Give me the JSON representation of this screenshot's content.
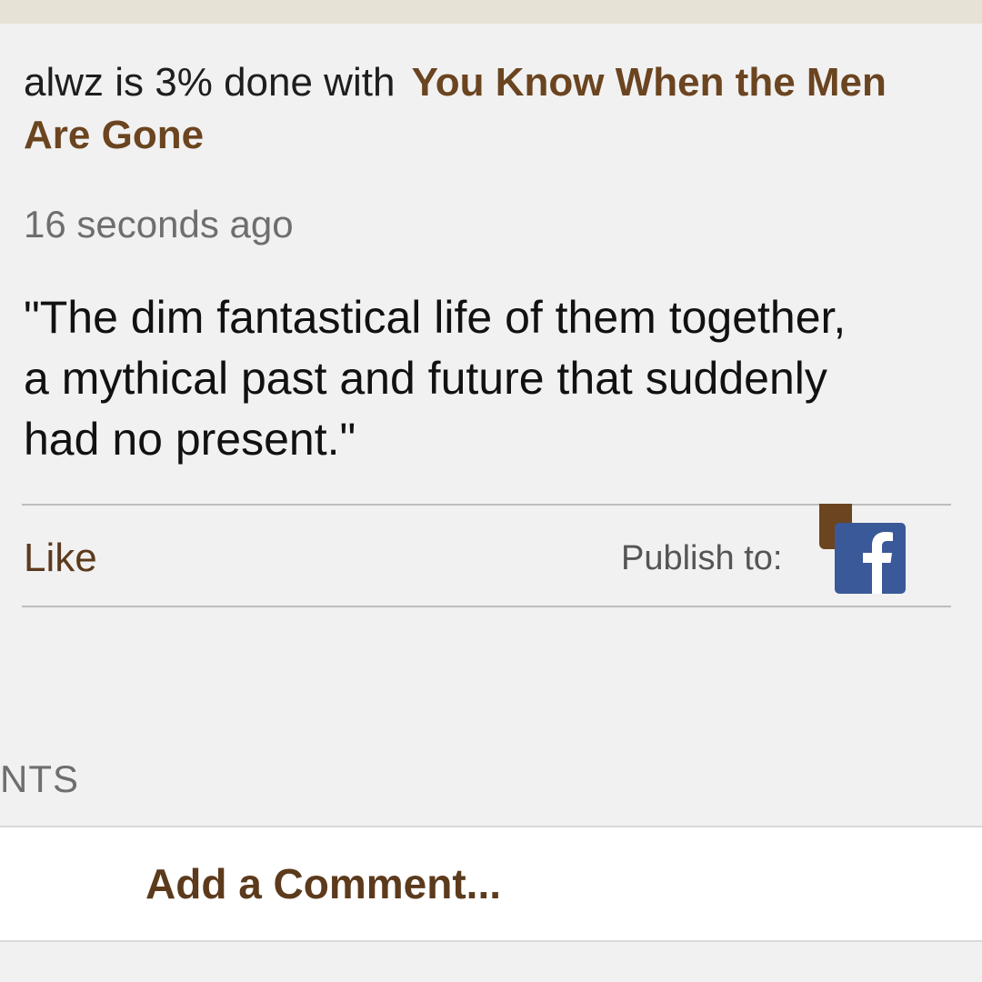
{
  "update": {
    "status_prefix": "alwz is 3% done with",
    "book_title": "You Know When the Men Are Gone",
    "progress_percent": 3,
    "timestamp": "16 seconds ago",
    "quote": "\"The dim fantastical life of them together,\na mythical past and future that suddenly\nhad no present.\""
  },
  "actions": {
    "like_label": "Like",
    "publish_label": "Publish to:",
    "publish_target_icon": "facebook-icon"
  },
  "comments": {
    "header": "NTS",
    "add_comment_label": "Add a Comment..."
  },
  "colors": {
    "link_brown": "#6b4420",
    "facebook_blue": "#3a5998"
  }
}
